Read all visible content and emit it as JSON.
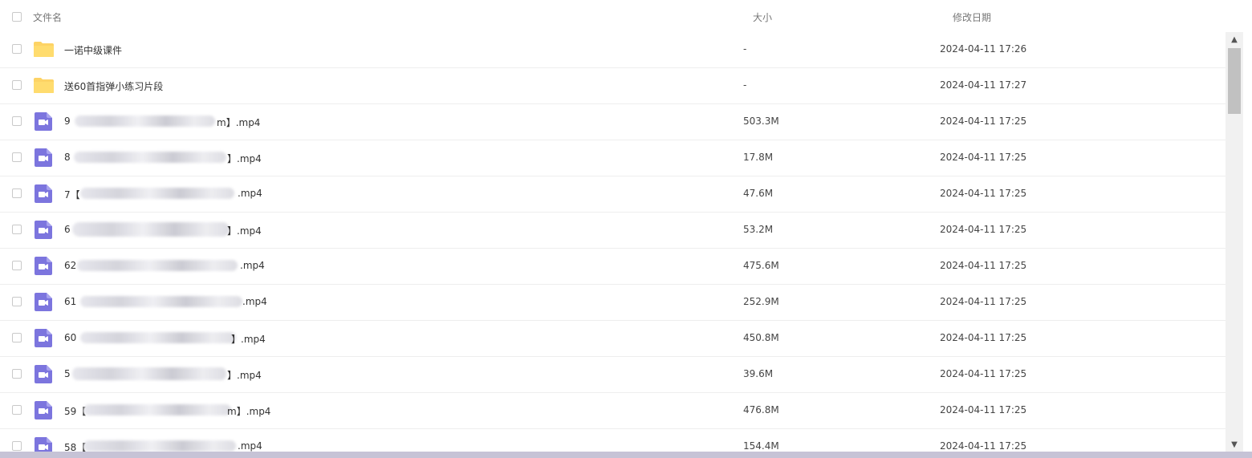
{
  "header": {
    "col_name": "文件名",
    "col_size": "大小",
    "col_date": "修改日期"
  },
  "files": [
    {
      "type": "folder",
      "prefix": "一诺中级课件",
      "suffix": "",
      "size": "-",
      "date": "2024-04-11 17:26"
    },
    {
      "type": "folder",
      "prefix": "送60首指弹小练习片段",
      "suffix": "",
      "size": "-",
      "date": "2024-04-11 17:27"
    },
    {
      "type": "video",
      "prefix": "9",
      "suffix": "m】.mp4",
      "size": "503.3M",
      "date": "2024-04-11 17:25"
    },
    {
      "type": "video",
      "prefix": "8",
      "suffix": "】.mp4",
      "size": "17.8M",
      "date": "2024-04-11 17:25"
    },
    {
      "type": "video",
      "prefix": "7【",
      "suffix": ".mp4",
      "size": "47.6M",
      "date": "2024-04-11 17:25"
    },
    {
      "type": "video",
      "prefix": "6",
      "suffix": "】.mp4",
      "size": "53.2M",
      "date": "2024-04-11 17:25"
    },
    {
      "type": "video",
      "prefix": "62",
      "suffix": ".mp4",
      "size": "475.6M",
      "date": "2024-04-11 17:25"
    },
    {
      "type": "video",
      "prefix": "61",
      "suffix": ".mp4",
      "size": "252.9M",
      "date": "2024-04-11 17:25"
    },
    {
      "type": "video",
      "prefix": "60",
      "suffix": "】.mp4",
      "size": "450.8M",
      "date": "2024-04-11 17:25"
    },
    {
      "type": "video",
      "prefix": "5",
      "suffix": "】.mp4",
      "size": "39.6M",
      "date": "2024-04-11 17:25"
    },
    {
      "type": "video",
      "prefix": "59【",
      "suffix": "m】.mp4",
      "size": "476.8M",
      "date": "2024-04-11 17:25"
    },
    {
      "type": "video",
      "prefix": "58【",
      "suffix": ".mp4",
      "size": "154.4M",
      "date": "2024-04-11 17:25"
    }
  ],
  "scrollbar": {
    "up": "▲",
    "down": "▼"
  }
}
